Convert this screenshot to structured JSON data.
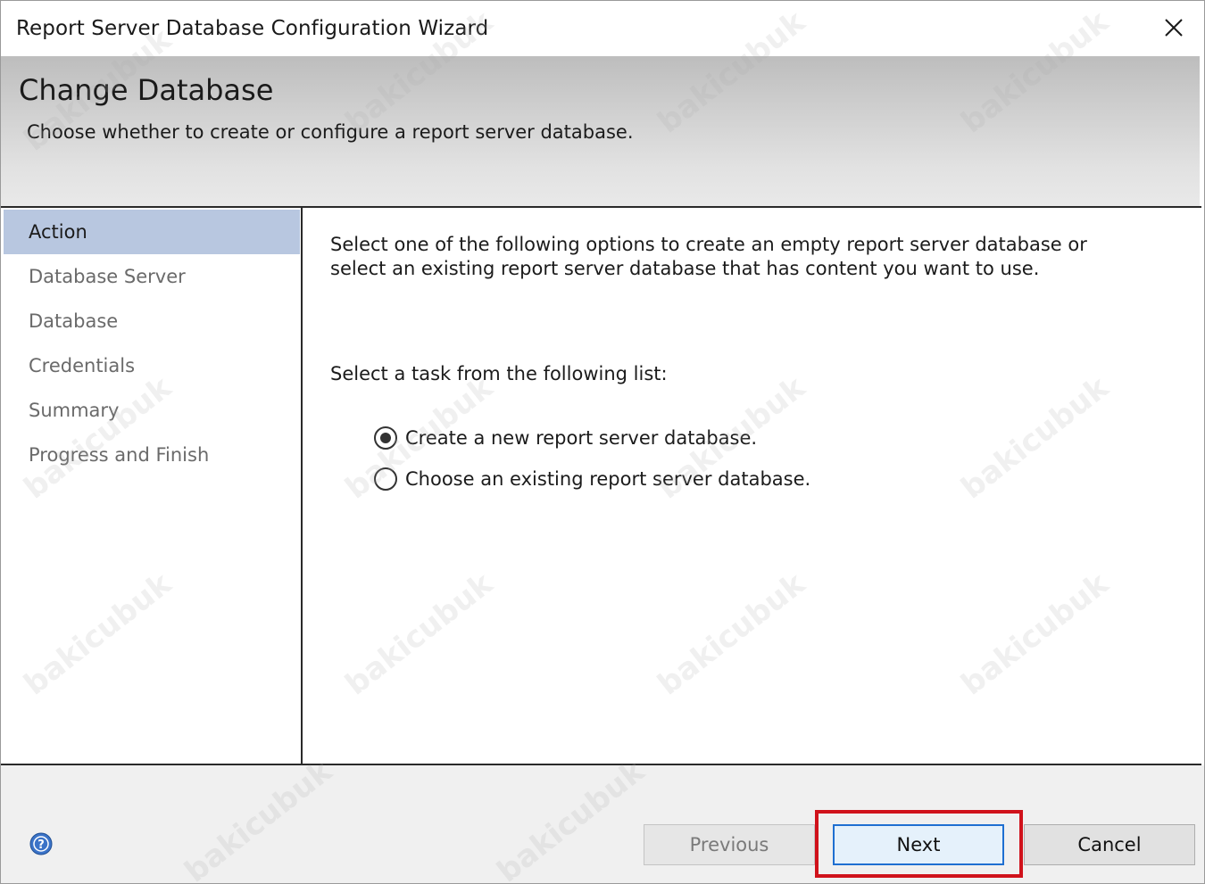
{
  "window": {
    "title": "Report Server Database Configuration Wizard",
    "close_icon": "close-icon"
  },
  "header": {
    "title": "Change Database",
    "description": "Choose whether to create or configure a report server database."
  },
  "sidebar": {
    "items": [
      {
        "label": "Action",
        "active": true
      },
      {
        "label": "Database Server",
        "active": false
      },
      {
        "label": "Database",
        "active": false
      },
      {
        "label": "Credentials",
        "active": false
      },
      {
        "label": "Summary",
        "active": false
      },
      {
        "label": "Progress and Finish",
        "active": false
      }
    ]
  },
  "main": {
    "instructions": "Select one of the following options to create an empty report server database or select an existing report server database that has content you want to use.",
    "task_label": "Select a task from the following list:",
    "options": [
      {
        "label": "Create a new report server database.",
        "selected": true
      },
      {
        "label": "Choose an existing report server database.",
        "selected": false
      }
    ]
  },
  "footer": {
    "help_icon": "help-icon",
    "previous_label": "Previous",
    "next_label": "Next",
    "cancel_label": "Cancel"
  },
  "watermark": "bakicubuk",
  "colors": {
    "sidebar_active": "#b8c7e0",
    "highlight_box": "#d0121b",
    "primary_button_border": "#1f6fd1"
  }
}
